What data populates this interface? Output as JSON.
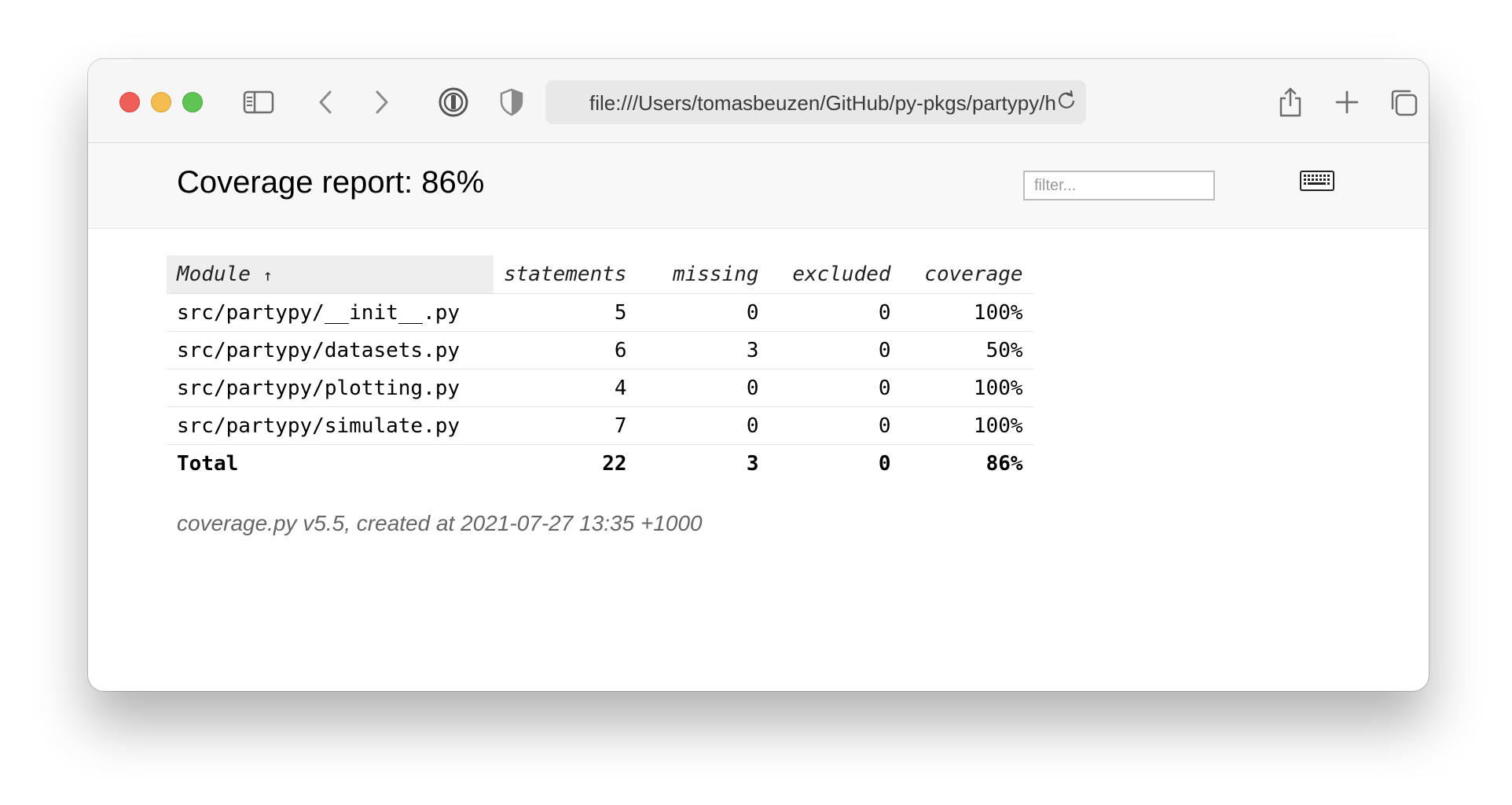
{
  "browser": {
    "url": "file:///Users/tomasbeuzen/GitHub/py-pkgs/partypy/h",
    "icons": [
      "sidebar-icon",
      "back-icon",
      "forward-icon",
      "password-manager-icon",
      "privacy-shield-icon",
      "reload-icon",
      "share-icon",
      "new-tab-icon",
      "tab-overview-icon"
    ]
  },
  "report": {
    "title": "Coverage report: 86%",
    "filter_placeholder": "filter...",
    "columns": {
      "module": "Module",
      "sort_indicator": "↑",
      "statements": "statements",
      "missing": "missing",
      "excluded": "excluded",
      "coverage": "coverage"
    },
    "rows": [
      {
        "module": "src/partypy/__init__.py",
        "statements": "5",
        "missing": "0",
        "excluded": "0",
        "coverage": "100%"
      },
      {
        "module": "src/partypy/datasets.py",
        "statements": "6",
        "missing": "3",
        "excluded": "0",
        "coverage": "50%"
      },
      {
        "module": "src/partypy/plotting.py",
        "statements": "4",
        "missing": "0",
        "excluded": "0",
        "coverage": "100%"
      },
      {
        "module": "src/partypy/simulate.py",
        "statements": "7",
        "missing": "0",
        "excluded": "0",
        "coverage": "100%"
      }
    ],
    "total": {
      "module": "Total",
      "statements": "22",
      "missing": "3",
      "excluded": "0",
      "coverage": "86%"
    },
    "footer": "coverage.py v5.5, created at 2021-07-27 13:35 +1000"
  },
  "colors": {
    "close": "#ee5f58",
    "minimize": "#f5bd4f",
    "zoom": "#5fc454"
  }
}
